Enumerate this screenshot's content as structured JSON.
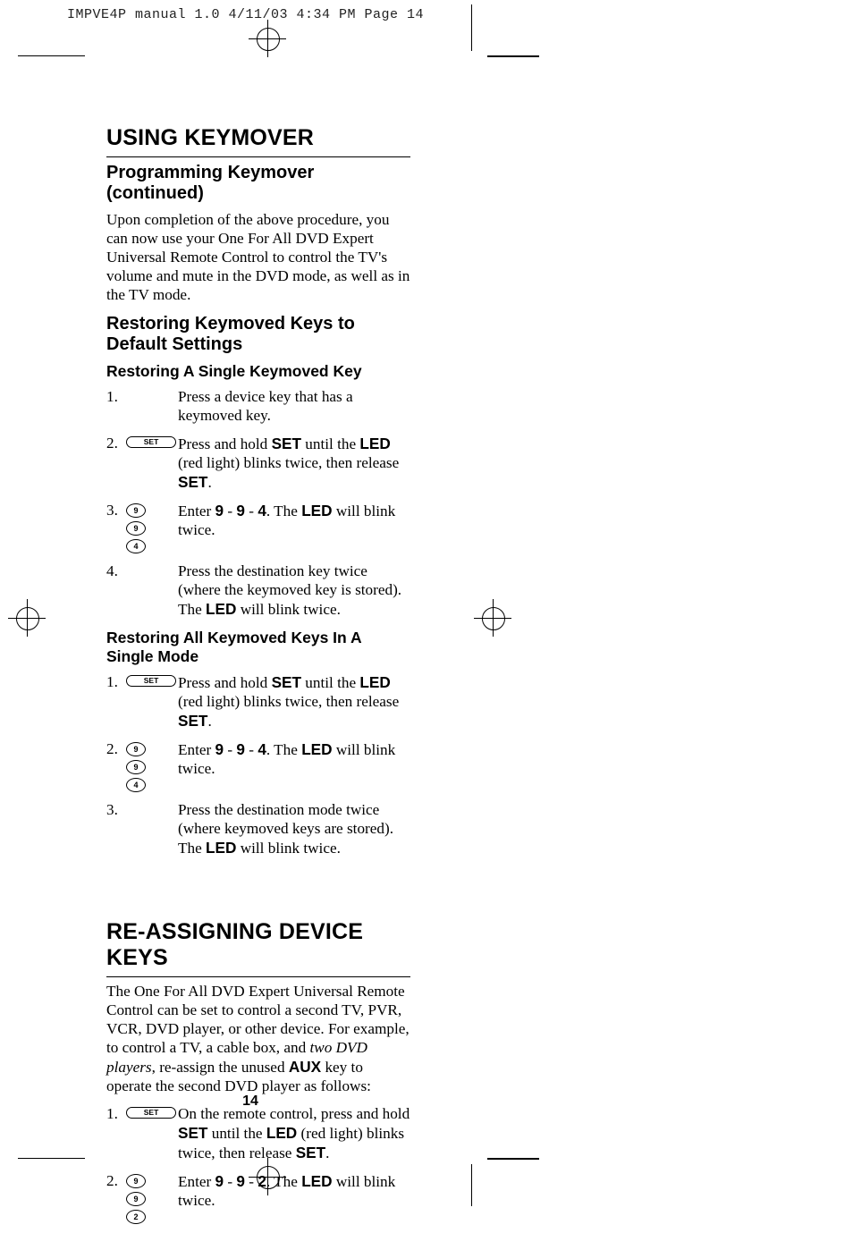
{
  "slug": "IMPVE4P manual 1.0  4/11/03  4:34 PM  Page 14",
  "page_number": "14",
  "section1": {
    "title": "USING KEYMOVER",
    "subtitle": "Programming Keymover (continued)",
    "intro": "Upon completion of the above procedure, you can now use your One For All DVD Expert Universal Remote Control to control the TV's volume and mute in the DVD mode, as well as in the TV mode.",
    "restore_heading": "Restoring Keymoved Keys to Default Settings",
    "single": {
      "heading": "Restoring A Single Keymoved Key",
      "step1": {
        "num": "1.",
        "text": "Press a device key that has a keymoved key."
      },
      "step2": {
        "num": "2.",
        "btn": "SET",
        "pre": "Press and hold ",
        "b1": "SET",
        "mid1": " until the ",
        "b2": "LED",
        "mid2": " (red light) blinks twice, then release ",
        "b3": "SET",
        "post": "."
      },
      "step3": {
        "num": "3.",
        "k1": "9",
        "k2": "9",
        "k3": "4",
        "pre": "Enter ",
        "c1": "9",
        "s1": " - ",
        "c2": "9",
        "s2": " - ",
        "c3": "4",
        "mid": ". The ",
        "b1": "LED",
        "post": " will blink twice."
      },
      "step4": {
        "num": "4.",
        "pre": "Press the destination key twice (where the keymoved key is stored). The ",
        "b1": "LED",
        "post": " will blink twice."
      }
    },
    "all": {
      "heading": "Restoring All Keymoved Keys In A Single Mode",
      "step1": {
        "num": "1.",
        "btn": "SET",
        "pre": "Press and hold ",
        "b1": "SET",
        "mid1": " until the ",
        "b2": "LED",
        "mid2": " (red light) blinks twice, then release ",
        "b3": "SET",
        "post": "."
      },
      "step2": {
        "num": "2.",
        "k1": "9",
        "k2": "9",
        "k3": "4",
        "pre": "Enter ",
        "c1": "9",
        "s1": " - ",
        "c2": "9",
        "s2": " - ",
        "c3": "4",
        "mid": ". The ",
        "b1": "LED",
        "post": " will blink twice."
      },
      "step3": {
        "num": "3.",
        "pre": "Press the destination mode twice (where keymoved keys are stored). The ",
        "b1": "LED",
        "post": " will blink twice."
      }
    }
  },
  "section2": {
    "title": "RE-ASSIGNING DEVICE KEYS",
    "intro_pre": "The One For All DVD Expert Universal Remote Control can be set to control a second TV, PVR, VCR, DVD player, or other device. For example, to control a TV, a cable box, and ",
    "intro_i": "two DVD players",
    "intro_mid": ", re-assign the unused ",
    "intro_b": "AUX",
    "intro_post": " key to operate the second DVD player as follows:",
    "step1": {
      "num": "1.",
      "btn": "SET",
      "pre": "On the remote control, press and hold ",
      "b1": "SET",
      "mid1": " until the ",
      "b2": "LED",
      "mid2": " (red light) blinks twice, then release ",
      "b3": "SET",
      "post": "."
    },
    "step2": {
      "num": "2.",
      "k1": "9",
      "k2": "9",
      "k3": "2",
      "pre": "Enter ",
      "c1": "9",
      "s1": " - ",
      "c2": " 9",
      "s2": " - ",
      "c3": "2",
      "mid": ". The ",
      "b1": "LED",
      "post": " will blink twice."
    }
  }
}
